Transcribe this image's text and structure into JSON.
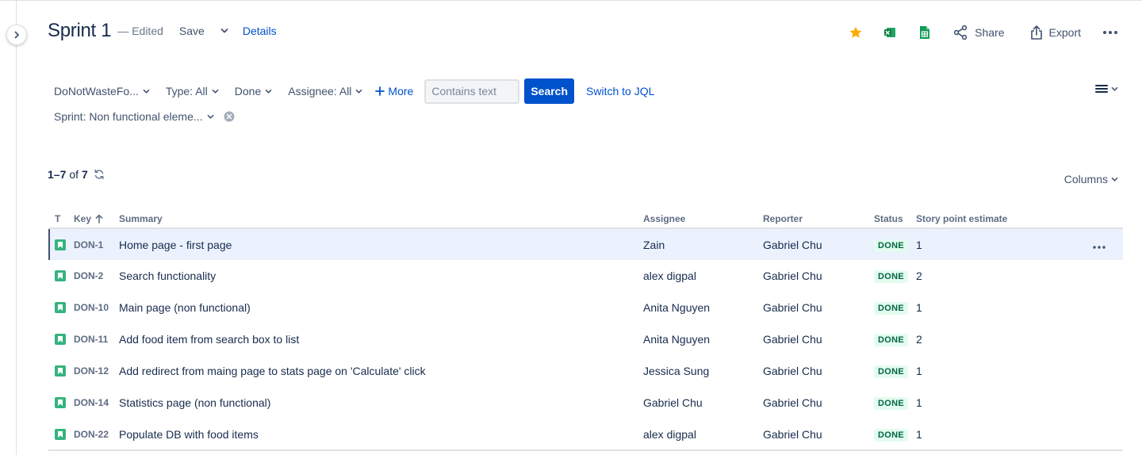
{
  "header": {
    "title": "Sprint 1",
    "edited": "— Edited",
    "save_label": "Save",
    "details_label": "Details"
  },
  "actions": {
    "share_label": "Share",
    "export_label": "Export"
  },
  "filters": {
    "project": "DoNotWasteFo...",
    "type": "Type: All",
    "status": "Done",
    "assignee": "Assignee: All",
    "more": "More",
    "search_placeholder": "Contains text",
    "search_button": "Search",
    "switch_jql": "Switch to JQL",
    "sprint": "Sprint: Non functional eleme..."
  },
  "results": {
    "range": "1–7",
    "of": "of",
    "total": "7",
    "columns_label": "Columns"
  },
  "table": {
    "headers": {
      "type": "T",
      "key": "Key",
      "summary": "Summary",
      "assignee": "Assignee",
      "reporter": "Reporter",
      "status": "Status",
      "story_points": "Story point estimate"
    },
    "rows": [
      {
        "key": "DON-1",
        "summary": "Home page - first page",
        "assignee": "Zain",
        "reporter": "Gabriel Chu",
        "status": "DONE",
        "points": "1"
      },
      {
        "key": "DON-2",
        "summary": "Search functionality",
        "assignee": "alex digpal",
        "reporter": "Gabriel Chu",
        "status": "DONE",
        "points": "2"
      },
      {
        "key": "DON-10",
        "summary": "Main page (non functional)",
        "assignee": "Anita Nguyen",
        "reporter": "Gabriel Chu",
        "status": "DONE",
        "points": "1"
      },
      {
        "key": "DON-11",
        "summary": "Add food item from search box to list",
        "assignee": "Anita Nguyen",
        "reporter": "Gabriel Chu",
        "status": "DONE",
        "points": "2"
      },
      {
        "key": "DON-12",
        "summary": "Add redirect from maing page to stats page on 'Calculate' click",
        "assignee": "Jessica Sung",
        "reporter": "Gabriel Chu",
        "status": "DONE",
        "points": "1"
      },
      {
        "key": "DON-14",
        "summary": "Statistics page (non functional)",
        "assignee": "Gabriel Chu",
        "reporter": "Gabriel Chu",
        "status": "DONE",
        "points": "1"
      },
      {
        "key": "DON-22",
        "summary": "Populate DB with food items",
        "assignee": "alex digpal",
        "reporter": "Gabriel Chu",
        "status": "DONE",
        "points": "1"
      }
    ]
  },
  "icons": {
    "star": "star-icon",
    "excel": "excel-icon",
    "sheets": "google-sheets-icon",
    "share": "share-icon",
    "export": "export-icon",
    "more": "more-icon",
    "story": "story-icon"
  },
  "colors": {
    "accent": "#0052cc",
    "star": "#ffab00",
    "story": "#36b37e",
    "done_bg": "#e3fcef",
    "done_text": "#006644",
    "selected_row": "#ebf2fe"
  }
}
